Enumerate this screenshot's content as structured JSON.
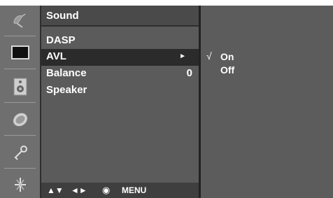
{
  "menu": {
    "title": "Sound",
    "items": [
      {
        "label": "DASP",
        "value": ""
      },
      {
        "label": "AVL",
        "value": "►"
      },
      {
        "label": "Balance",
        "value": "0"
      },
      {
        "label": "Speaker",
        "value": ""
      }
    ],
    "selected_index": 1
  },
  "submenu": {
    "items": [
      {
        "label": "On",
        "check": "√"
      },
      {
        "label": "Off",
        "check": ""
      }
    ]
  },
  "footer": {
    "up_down": "▲▼",
    "left_right": "◄►",
    "ok": "◉",
    "menu": "MENU"
  },
  "icons": [
    "satellite-dish-icon",
    "screen-icon",
    "speaker-icon",
    "clock-icon",
    "key-icon",
    "plug-icon"
  ]
}
